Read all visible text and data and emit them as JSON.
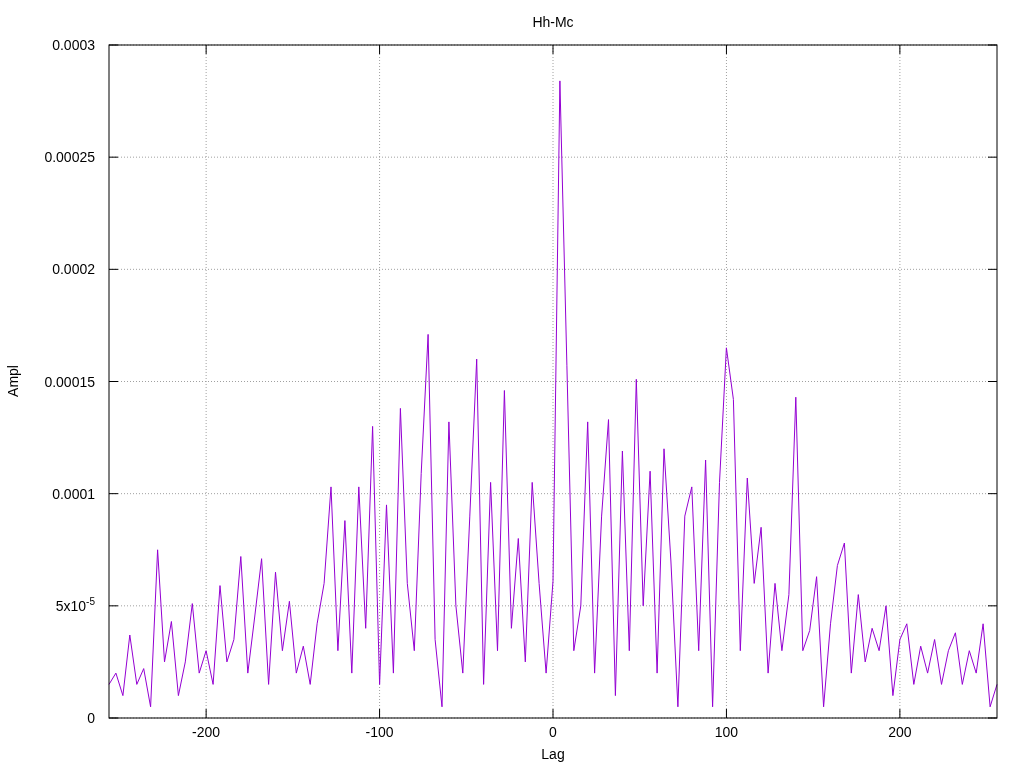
{
  "chart_data": {
    "type": "line",
    "title": "Hh-Mc",
    "xlabel": "Lag",
    "ylabel": "Ampl",
    "x": [
      -256,
      -252,
      -248,
      -244,
      -240,
      -236,
      -232,
      -228,
      -224,
      -220,
      -216,
      -212,
      -208,
      -204,
      -200,
      -196,
      -192,
      -188,
      -184,
      -180,
      -176,
      -172,
      -168,
      -164,
      -160,
      -156,
      -152,
      -148,
      -144,
      -140,
      -136,
      -132,
      -128,
      -124,
      -120,
      -116,
      -112,
      -108,
      -104,
      -100,
      -96,
      -92,
      -88,
      -84,
      -80,
      -76,
      -72,
      -68,
      -64,
      -60,
      -56,
      -52,
      -48,
      -44,
      -40,
      -36,
      -32,
      -28,
      -24,
      -20,
      -16,
      -12,
      -8,
      -4,
      0,
      4,
      8,
      12,
      16,
      20,
      24,
      28,
      32,
      36,
      40,
      44,
      48,
      52,
      56,
      60,
      64,
      68,
      72,
      76,
      80,
      84,
      88,
      92,
      96,
      100,
      104,
      108,
      112,
      116,
      120,
      124,
      128,
      132,
      136,
      140,
      144,
      148,
      152,
      156,
      160,
      164,
      168,
      172,
      176,
      180,
      184,
      188,
      192,
      196,
      200,
      204,
      208,
      212,
      216,
      220,
      224,
      228,
      232,
      236,
      240,
      244,
      248,
      252,
      256
    ],
    "series": [
      {
        "color": "#9400d3",
        "values": [
          1.5e-05,
          2e-05,
          1e-05,
          3.7e-05,
          1.5e-05,
          2.2e-05,
          5e-06,
          7.5e-05,
          2.5e-05,
          4.3e-05,
          1e-05,
          2.5e-05,
          5.1e-05,
          2e-05,
          3e-05,
          1.5e-05,
          5.9e-05,
          2.5e-05,
          3.5e-05,
          7.2e-05,
          2e-05,
          4.5e-05,
          7.1e-05,
          1.5e-05,
          6.5e-05,
          3e-05,
          5.2e-05,
          2e-05,
          3.2e-05,
          1.5e-05,
          4.2e-05,
          6e-05,
          0.000103,
          3e-05,
          8.8e-05,
          2e-05,
          0.000103,
          4e-05,
          0.00013,
          1.5e-05,
          9.5e-05,
          2e-05,
          0.000138,
          6e-05,
          3e-05,
          0.000109,
          0.000171,
          3.5e-05,
          5e-06,
          0.000132,
          5e-05,
          2e-05,
          9e-05,
          0.00016,
          1.5e-05,
          0.000105,
          3e-05,
          0.000146,
          4e-05,
          8e-05,
          2.5e-05,
          0.000105,
          6e-05,
          2e-05,
          6.1e-05,
          0.000284,
          0.000157,
          3e-05,
          5e-05,
          0.000132,
          2e-05,
          9e-05,
          0.000133,
          1e-05,
          0.000119,
          3e-05,
          0.000151,
          5e-05,
          0.00011,
          2e-05,
          0.00012,
          7e-05,
          5e-06,
          9e-05,
          0.000103,
          3e-05,
          0.000115,
          5e-06,
          0.000105,
          0.000165,
          0.000142,
          3e-05,
          0.000107,
          6e-05,
          8.5e-05,
          2e-05,
          6e-05,
          3e-05,
          5.5e-05,
          0.000143,
          3e-05,
          3.9e-05,
          6.3e-05,
          5e-06,
          4.2e-05,
          6.8e-05,
          7.8e-05,
          2e-05,
          5.5e-05,
          2.5e-05,
          4e-05,
          3e-05,
          5e-05,
          1e-05,
          3.5e-05,
          4.2e-05,
          1.5e-05,
          3.2e-05,
          2e-05,
          3.5e-05,
          1.5e-05,
          3e-05,
          3.8e-05,
          1.5e-05,
          3e-05,
          2e-05,
          4.2e-05,
          5e-06,
          1.5e-05
        ]
      }
    ],
    "grid": true,
    "xlim": [
      -256,
      256
    ],
    "ylim": [
      0,
      0.0003
    ],
    "xticks": [
      -200,
      -100,
      0,
      100,
      200
    ],
    "yticks": [
      {
        "value": 0,
        "label": "0"
      },
      {
        "value": 5e-05,
        "label": "5x10$^{-5}$"
      },
      {
        "value": 0.0001,
        "label": "0.0001"
      },
      {
        "value": 0.00015,
        "label": "0.00015"
      },
      {
        "value": 0.0002,
        "label": "0.0002"
      },
      {
        "value": 0.00025,
        "label": "0.00025"
      },
      {
        "value": 0.0003,
        "label": "0.0003"
      }
    ]
  }
}
